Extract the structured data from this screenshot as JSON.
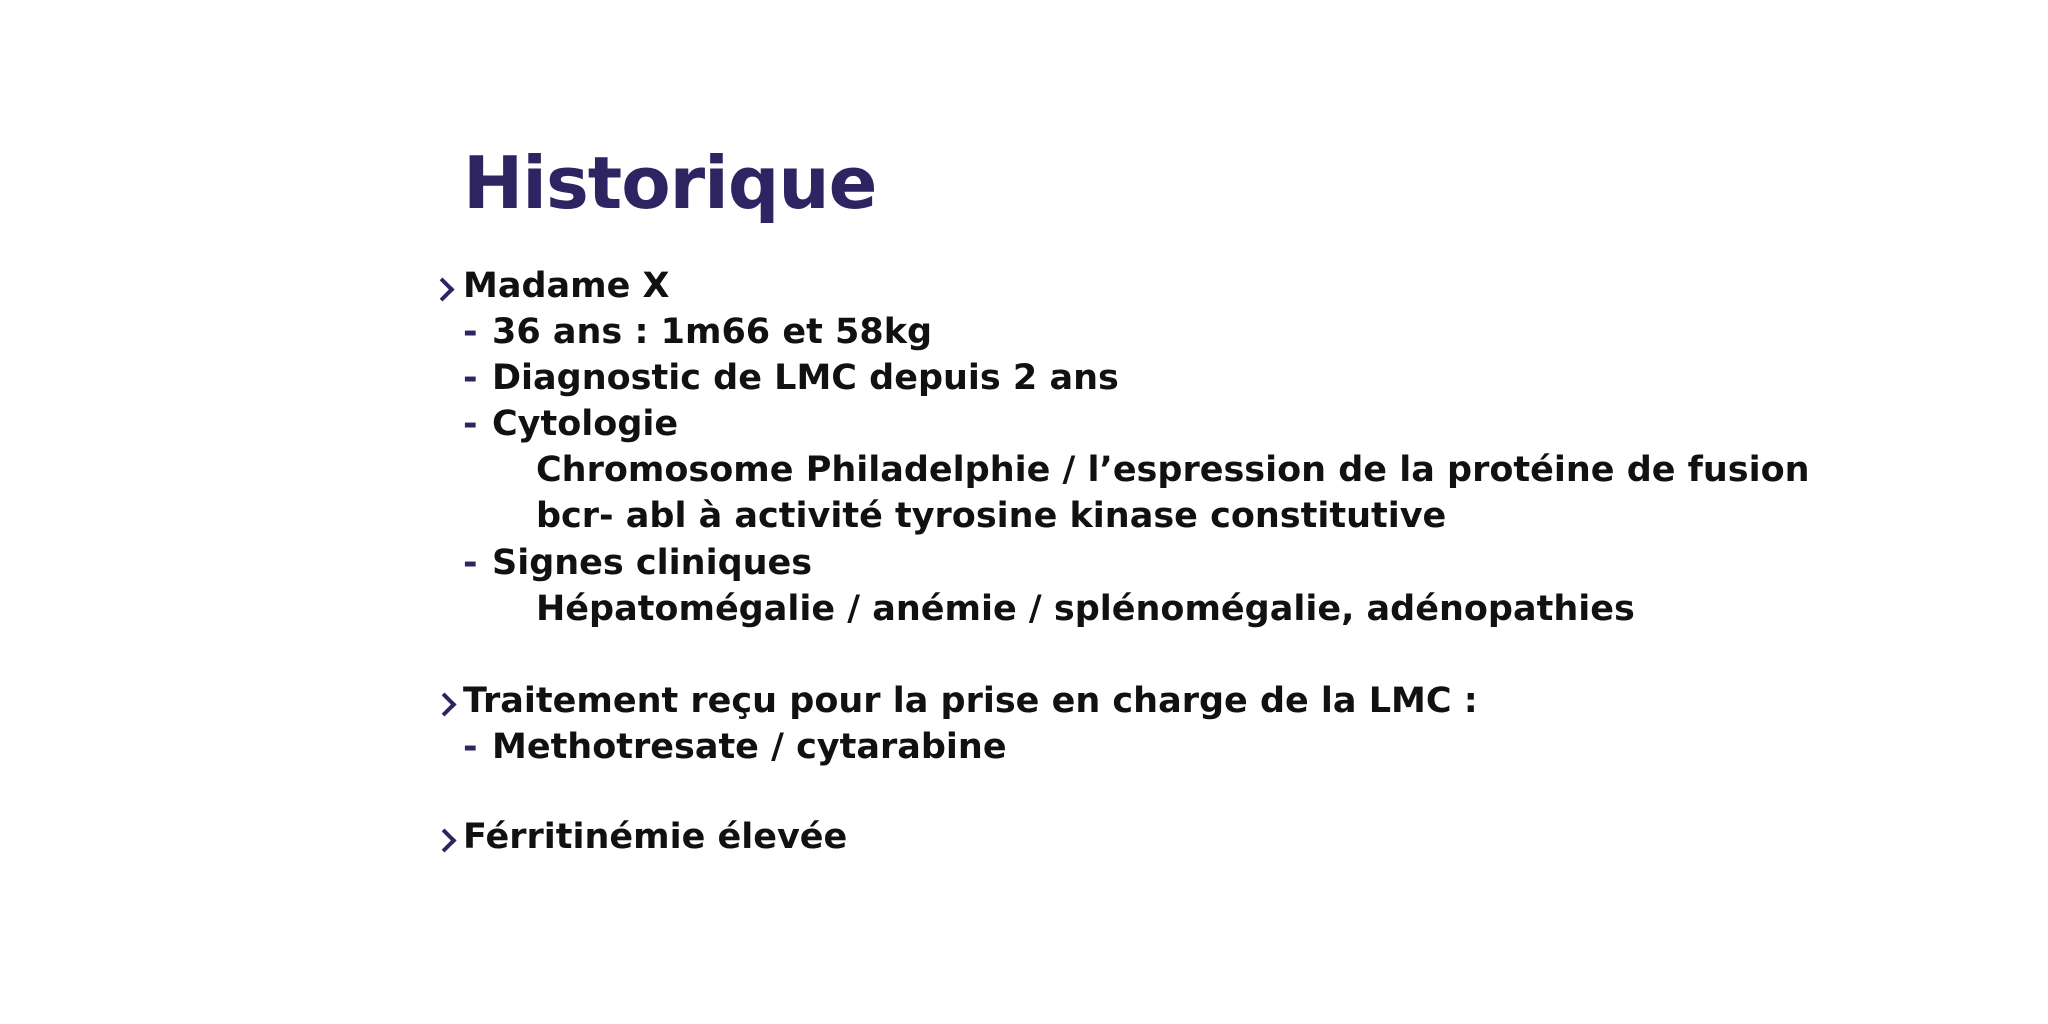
{
  "title": "Historique",
  "sections": [
    {
      "heading": "Madame X",
      "items": [
        "36 ans : 1m66 et 58kg",
        "Diagnostic de LMC depuis 2 ans",
        "Cytologie",
        "Signes cliniques"
      ],
      "cytologie_detail": [
        "Chromosome Philadelphie / l’espression de la protéine de fusion",
        "bcr- abl à activité tyrosine kinase constitutive"
      ],
      "signes_detail": "Hépatomégalie / anémie / splénomégalie, adénopathies"
    },
    {
      "heading": "Traitement reçu pour la prise en charge de la LMC :",
      "items": [
        "Methotresate / cytarabine"
      ]
    },
    {
      "heading": "Férritinémie élevée"
    }
  ],
  "icons": {
    "bullet": "chevron-right-icon",
    "sub_bullet": "-"
  },
  "colors": {
    "accent": "#2d2461",
    "text": "#111111",
    "background": "#ffffff"
  }
}
